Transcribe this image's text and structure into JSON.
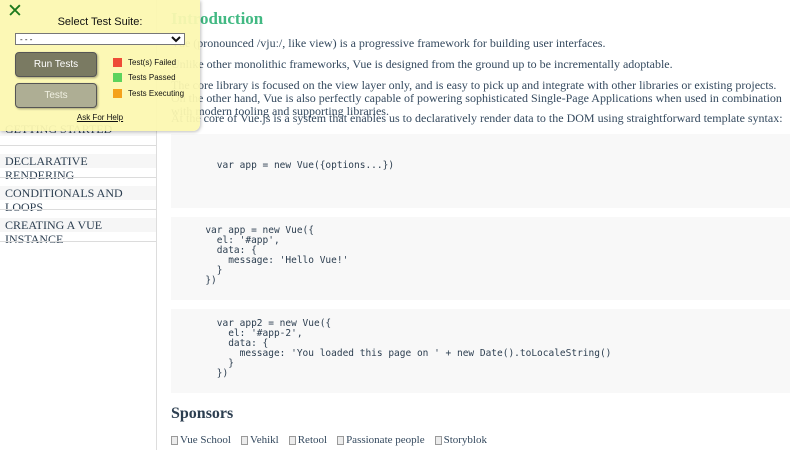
{
  "sidebar": {
    "items": [
      {
        "label": "GETTING STARTED"
      },
      {
        "label": "DECLARATIVE RENDERING"
      },
      {
        "label": "CONDITIONALS AND LOOPS"
      },
      {
        "label": "CREATING A VUE INSTANCE"
      }
    ]
  },
  "main": {
    "title": "Introduction",
    "para1": "Vue (pronounced /vjuː/, like view) is a progressive framework for building user interfaces.",
    "para2": "Unlike other monolithic frameworks, Vue is designed from the ground up to be incrementally adoptable.",
    "para3": "The core library is focused on the view layer only, and is easy to pick up and integrate with other libraries or existing projects. On the other hand, Vue is also perfectly capable of powering sophisticated Single-Page Applications when used in combination with modern tooling and supporting libraries.",
    "para4": "At the core of Vue.js is a system that enables us to declaratively render data to the DOM using straightforward template syntax:",
    "code1": "        var app = new Vue({options...})",
    "code2": "      var app = new Vue({\n        el: '#app',\n        data: {\n          message: 'Hello Vue!'\n        }\n      })",
    "code3": "        var app2 = new Vue({\n          el: '#app-2',\n          data: {\n            message: 'You loaded this page on ' + new Date().toLocaleString()\n          }\n        })",
    "sponsors_title": "Sponsors",
    "sponsors": [
      "Vue School",
      "Vehikl",
      "Retool",
      "Passionate people",
      "Storyblok"
    ]
  },
  "panel": {
    "title": "Select Test Suite:",
    "select_value": "- - -",
    "run_label": "Run Tests",
    "tests_label": "Tests",
    "legend": [
      {
        "label": "Test(s) Failed",
        "color": "#ee4c36"
      },
      {
        "label": "Tests Passed",
        "color": "#5cd35c"
      },
      {
        "label": "Tests Executing",
        "color": "#f4a21c"
      }
    ],
    "help_label": "Ask For Help"
  },
  "colors": {
    "accent": "#42b983",
    "close": "#1d7a1d",
    "panel_bg": "#fcf8b0"
  }
}
